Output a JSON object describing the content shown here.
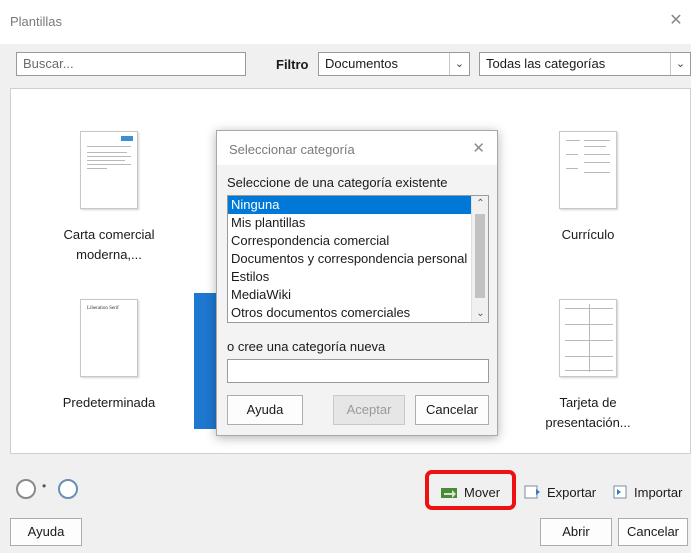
{
  "window": {
    "title": "Plantillas",
    "close_glyph": "✕"
  },
  "search": {
    "placeholder": "Buscar..."
  },
  "filter": {
    "label": "Filtro",
    "type_value": "Documentos",
    "category_value": "Todas las categorías"
  },
  "templates": [
    {
      "name_line1": "Carta comercial",
      "name_line2": "moderna,..."
    },
    {
      "name_line1": "Currículo",
      "name_line2": ""
    },
    {
      "name_line1": "Predeterminada",
      "name_line2": ""
    },
    {
      "name_line1": "Tarjeta de",
      "name_line2": "presentación..."
    }
  ],
  "thumb_texts": {
    "predeterminada": "Liberation Serif"
  },
  "actions": {
    "move": "Mover",
    "export": "Exportar",
    "import": "Importar"
  },
  "buttons": {
    "help": "Ayuda",
    "open": "Abrir",
    "cancel": "Cancelar"
  },
  "dialog": {
    "title": "Seleccionar categoría",
    "existing_label": "Seleccione de una categoría existente",
    "categories": [
      "Ninguna",
      "Mis plantillas",
      "Correspondencia comercial",
      "Documentos y correspondencia personal",
      "Estilos",
      "MediaWiki",
      "Otros documentos comerciales"
    ],
    "selected_index": 0,
    "new_label": "o cree una categoría nueva",
    "new_value": "",
    "help": "Ayuda",
    "accept": "Aceptar",
    "cancel": "Cancelar"
  },
  "colors": {
    "accent": "#0078d7",
    "highlight": "#ee1111",
    "selected_tile": "#1e78d0"
  }
}
